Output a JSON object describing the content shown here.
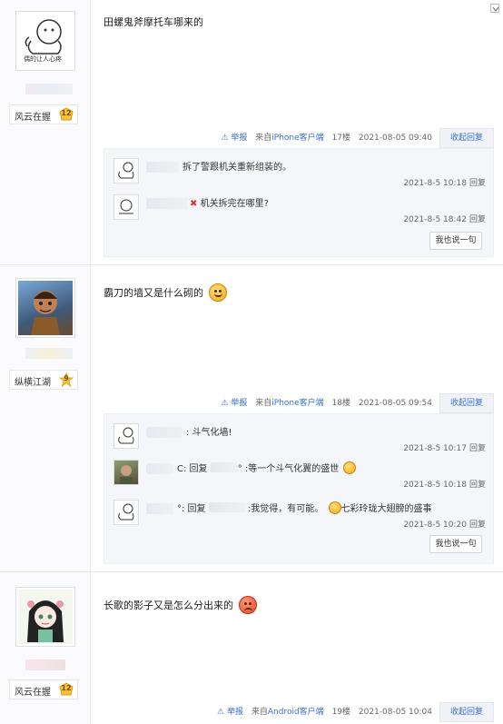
{
  "posts": [
    {
      "content": "田螺鬼斧摩托车哪来的",
      "badge_title": "风云在握",
      "badge_level": "12",
      "avatar_text": "偶的让人心疼",
      "tail": {
        "report": "举报",
        "source_prefix": "来自",
        "client": "iPhone客户端",
        "floor": "17楼",
        "time": "2021-08-05 09:40"
      },
      "fold_label": "收起回复",
      "replies": [
        {
          "text": "拆了警跟机关重新组装的。",
          "time": "2021-8-5 10:18",
          "reply_label": "回复"
        },
        {
          "text": "机关拆完在哪里?",
          "time": "2021-8-5 18:42",
          "reply_label": "回复"
        }
      ],
      "say_label": "我也说一句"
    },
    {
      "content": "霸刀的墙又是什么砌的",
      "badge_title": "纵横江湖",
      "badge_level": "9",
      "tail": {
        "report": "举报",
        "source_prefix": "来自",
        "client": "iPhone客户端",
        "floor": "18楼",
        "time": "2021-08-05 09:54"
      },
      "fold_label": "收起回复",
      "replies": [
        {
          "text": ": 斗气化墙!",
          "time": "2021-8-5 10:17",
          "reply_label": "回复"
        },
        {
          "prefix": "C: 回复",
          "suffix": "°",
          "text": ":等一个斗气化翼的盛世",
          "time": "2021-8-5 10:18",
          "reply_label": "回复"
        },
        {
          "prefix": "°: 回复",
          "text": ":我觉得，有可能。",
          "extra": "七彩玲珑大翅膀的盛事",
          "time": "2021-8-5 10:20",
          "reply_label": "回复"
        }
      ],
      "say_label": "我也说一句"
    },
    {
      "content": "长歌的影子又是怎么分出来的",
      "badge_title": "风云在握",
      "badge_level": "12",
      "tail": {
        "report": "举报",
        "source_prefix": "来自",
        "client": "Android客户端",
        "floor": "19楼",
        "time": "2021-08-05 10:04"
      },
      "fold_label": "收起回复"
    }
  ],
  "colors": {
    "link": "#3b6fd9",
    "accent_badge": "#f7c23a"
  },
  "icons": [
    "warning-icon",
    "level-badge-icon",
    "dropdown-icon",
    "smile-emoji",
    "angry-emoji"
  ]
}
